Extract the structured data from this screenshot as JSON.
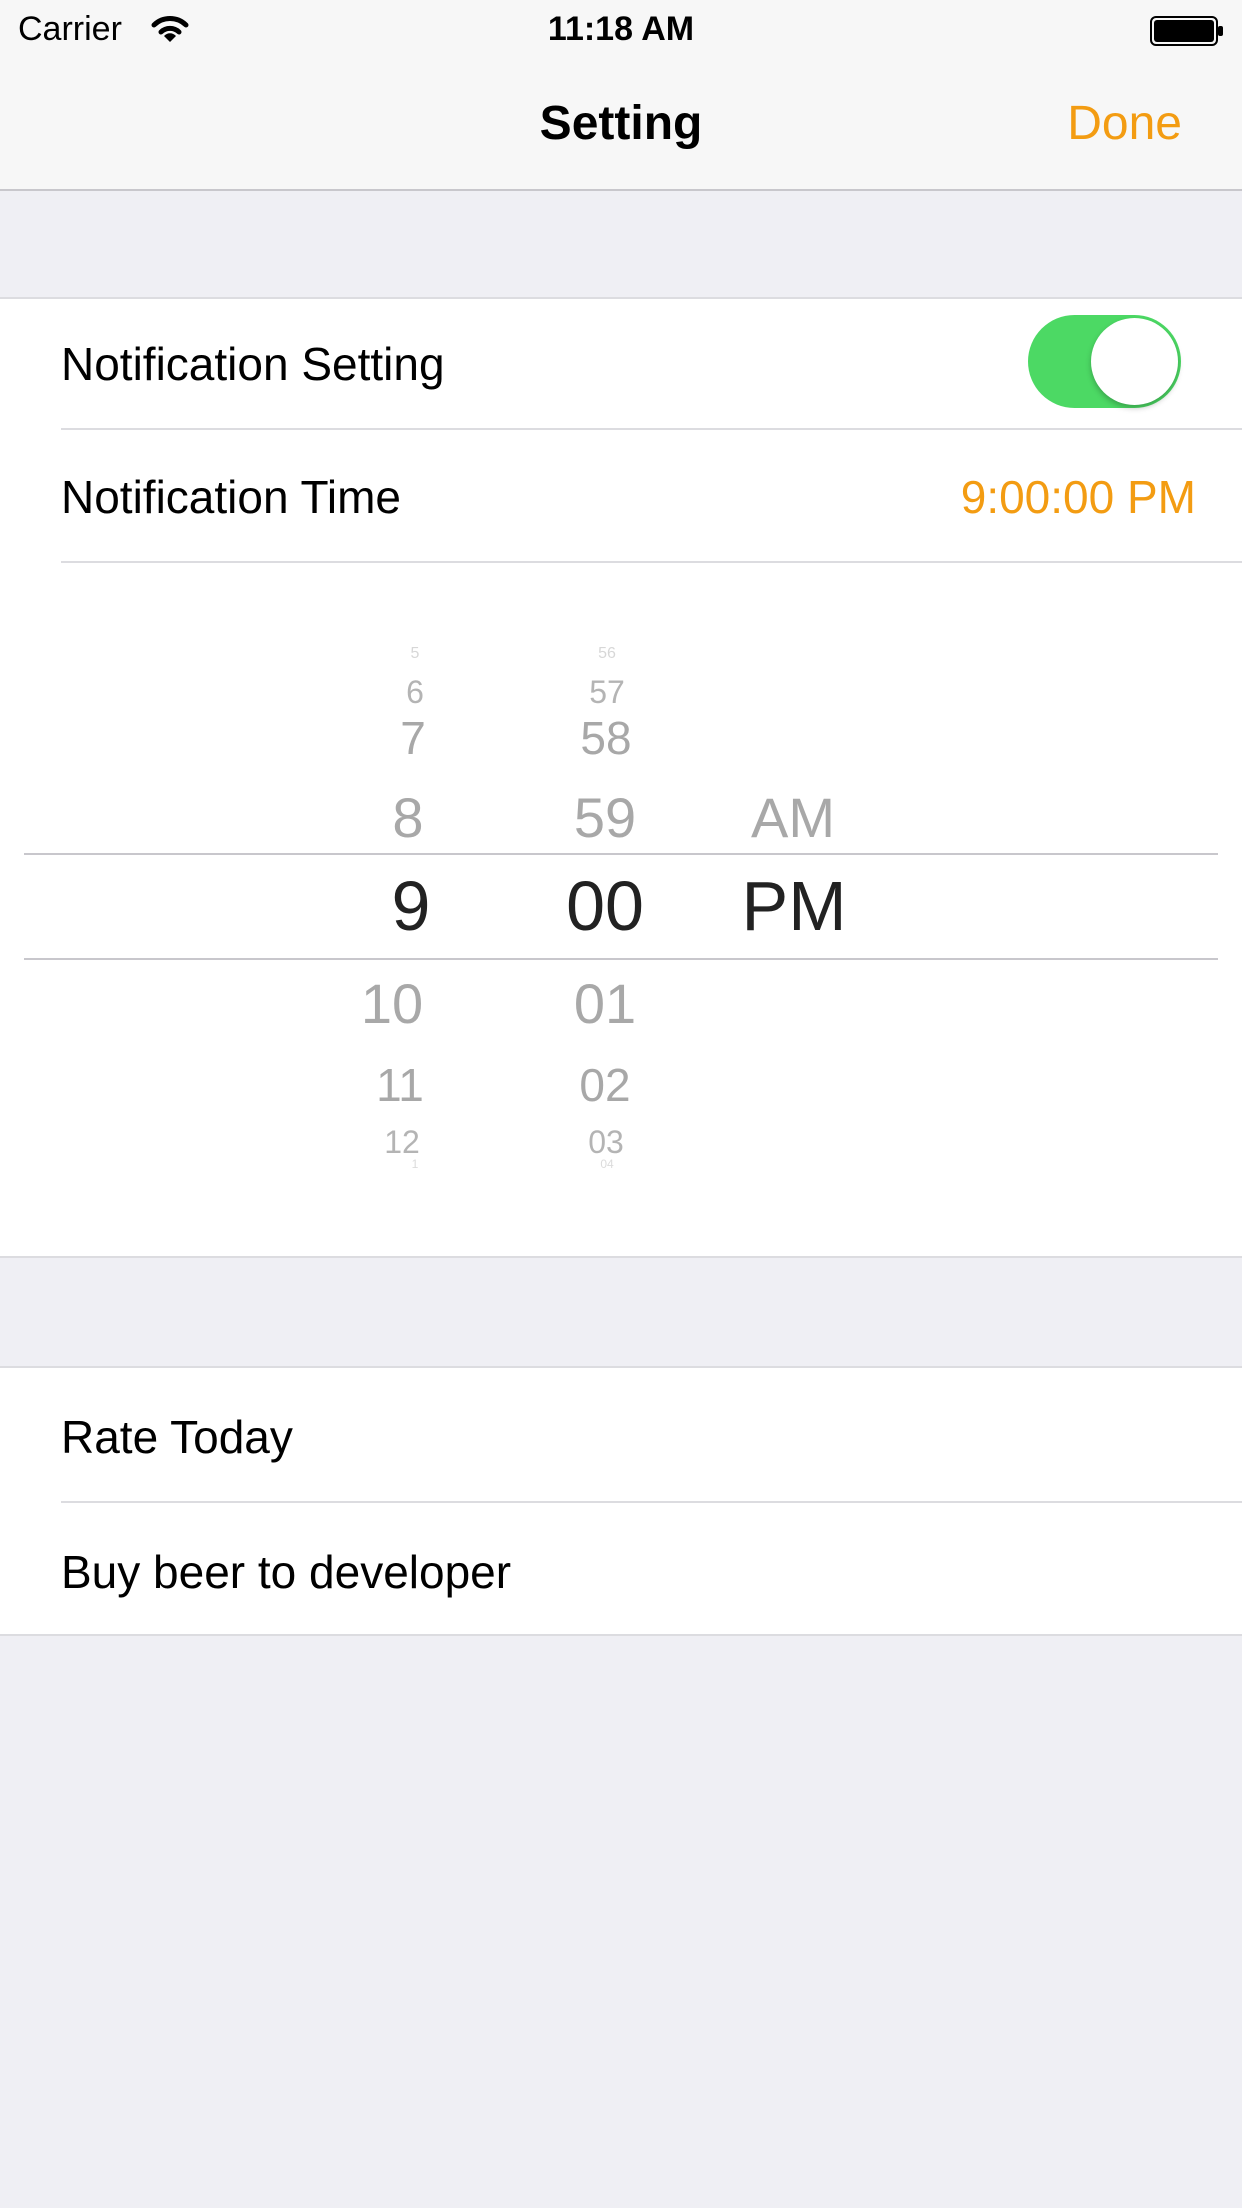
{
  "status_bar": {
    "carrier": "Carrier",
    "time": "11:18 AM"
  },
  "nav": {
    "title": "Setting",
    "done_label": "Done",
    "accent_color": "#f39c12"
  },
  "settings": {
    "notification_setting": {
      "label": "Notification Setting",
      "enabled": true,
      "toggle_color": "#4cd964"
    },
    "notification_time": {
      "label": "Notification Time",
      "value": "9:00:00 PM"
    }
  },
  "picker": {
    "hours": [
      "5",
      "6",
      "7",
      "8",
      "9",
      "10",
      "11",
      "12",
      "1"
    ],
    "minutes": [
      "56",
      "57",
      "58",
      "59",
      "00",
      "01",
      "02",
      "03",
      "04"
    ],
    "periods": [
      "AM",
      "PM"
    ],
    "selected_hour": "9",
    "selected_minute": "00",
    "selected_period": "PM"
  },
  "extras": {
    "rate_today": "Rate Today",
    "buy_beer": "Buy beer to developer"
  }
}
